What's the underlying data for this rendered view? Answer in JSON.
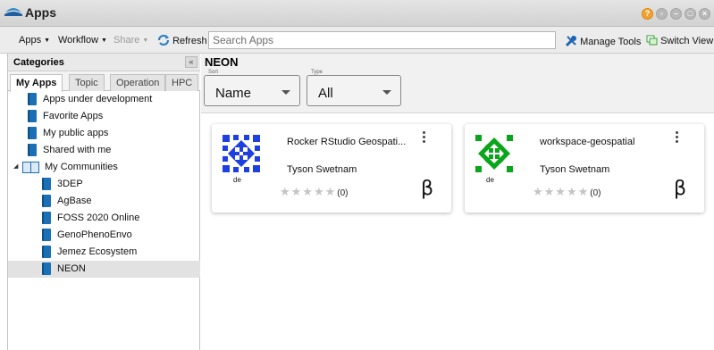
{
  "window": {
    "title": "Apps",
    "controls": [
      "help",
      "window",
      "minimize",
      "maximize",
      "close"
    ]
  },
  "toolbar": {
    "apps_label": "Apps",
    "workflow_label": "Workflow",
    "share_label": "Share",
    "refresh_label": "Refresh",
    "search_placeholder": "Search Apps",
    "manage_tools_label": "Manage Tools",
    "switch_view_label": "Switch View"
  },
  "sidebar": {
    "title": "Categories",
    "tabs": [
      {
        "label": "My Apps",
        "active": true
      },
      {
        "label": "Topic",
        "active": false
      },
      {
        "label": "Operation",
        "active": false
      },
      {
        "label": "HPC",
        "active": false
      }
    ],
    "items": [
      {
        "label": "Apps under development"
      },
      {
        "label": "Favorite Apps"
      },
      {
        "label": "My public apps"
      },
      {
        "label": "Shared with me"
      }
    ],
    "communities": {
      "label": "My Communities",
      "items": [
        {
          "label": "3DEP"
        },
        {
          "label": "AgBase"
        },
        {
          "label": "FOSS 2020 Online"
        },
        {
          "label": "GenoPhenoEnvo"
        },
        {
          "label": "Jemez Ecosystem"
        },
        {
          "label": "NEON",
          "selected": true
        }
      ]
    }
  },
  "main": {
    "title": "NEON",
    "sort": {
      "caption": "Sort",
      "value": "Name"
    },
    "type": {
      "caption": "Type",
      "value": "All"
    },
    "cards": [
      {
        "name": "Rocker RStudio Geospati...",
        "author": "Tyson Swetnam",
        "logo_label": "de",
        "rating": "(0)",
        "badge": "β",
        "logo_color": "#1f3fe0"
      },
      {
        "name": "workspace-geospatial",
        "author": "Tyson Swetnam",
        "logo_label": "de",
        "rating": "(0)",
        "badge": "β",
        "logo_color": "#0aa51a"
      }
    ]
  },
  "colors": {
    "accent": "#1a6fb5",
    "help": "#f2a22a"
  }
}
